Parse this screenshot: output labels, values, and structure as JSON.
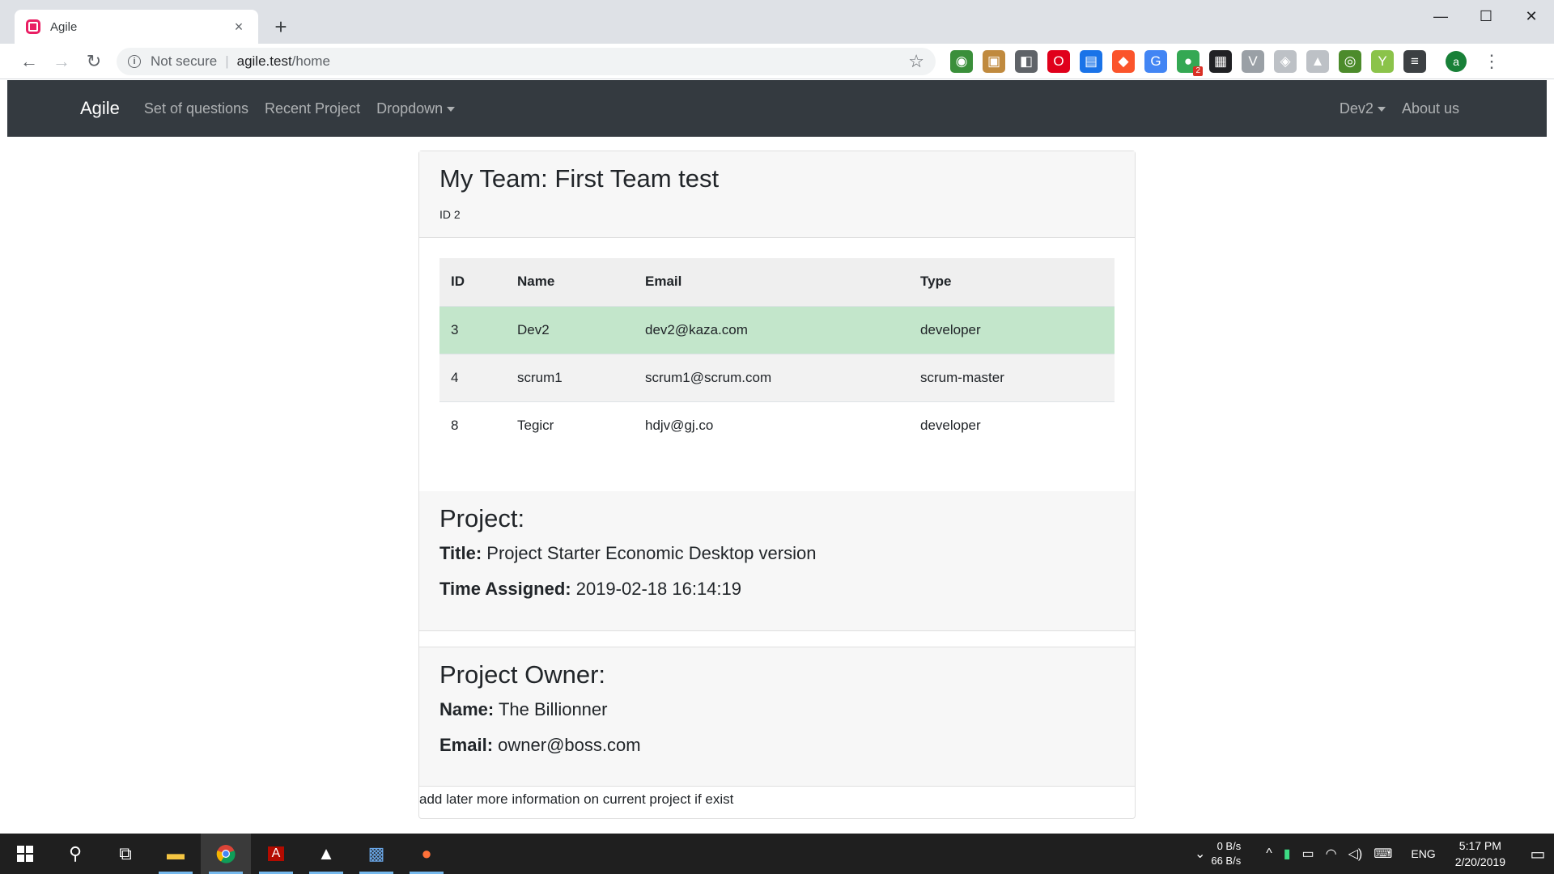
{
  "browser": {
    "tab_title": "Agile",
    "tab_close": "×",
    "new_tab": "+",
    "window_controls": {
      "minimize": "—",
      "maximize": "☐",
      "close": "✕"
    },
    "nav": {
      "back": "←",
      "forward": "→",
      "reload": "↻"
    },
    "address": {
      "security": "Not secure",
      "host": "agile.test",
      "path": "/home",
      "info_icon": "i",
      "star": "☆"
    },
    "profile_initial": "a",
    "menu": "⋮",
    "extensions": [
      {
        "icon": "globe-extension-icon",
        "color": "#3a8f3a",
        "glyph": "◉"
      },
      {
        "icon": "box-extension-icon",
        "color": "#c08a3e",
        "glyph": "▣"
      },
      {
        "icon": "puzzle-extension-icon",
        "color": "#5f6368",
        "glyph": "◧"
      },
      {
        "icon": "opera-extension-icon",
        "color": "#e0001b",
        "glyph": "O"
      },
      {
        "icon": "window-extension-icon",
        "color": "#1a73e8",
        "glyph": "▤"
      },
      {
        "icon": "brave-extension-icon",
        "color": "#fb542b",
        "glyph": "◆"
      },
      {
        "icon": "translate-extension-icon",
        "color": "#4285f4",
        "glyph": "G"
      },
      {
        "icon": "badge-extension-icon",
        "color": "#34a853",
        "glyph": "●",
        "badge": "2"
      },
      {
        "icon": "qr-extension-icon",
        "color": "#202124",
        "glyph": "▦"
      },
      {
        "icon": "v-extension-icon",
        "color": "#9aa0a6",
        "glyph": "V"
      },
      {
        "icon": "shield-extension-icon",
        "color": "#bdc1c6",
        "glyph": "◈"
      },
      {
        "icon": "drive-extension-icon",
        "color": "#bdc1c6",
        "glyph": "▲"
      },
      {
        "icon": "search-extension-icon",
        "color": "#4c8b2b",
        "glyph": "◎"
      },
      {
        "icon": "y-extension-icon",
        "color": "#8bc34a",
        "glyph": "Y"
      },
      {
        "icon": "list-extension-icon",
        "color": "#3c4043",
        "glyph": "≡"
      }
    ]
  },
  "navbar": {
    "brand": "Agile",
    "links": [
      "Set of questions",
      "Recent Project",
      "Dropdown"
    ],
    "user": "Dev2",
    "about": "About us"
  },
  "team": {
    "title": "My Team: First Team test",
    "subtitle": "ID 2",
    "columns": [
      "ID",
      "Name",
      "Email",
      "Type"
    ],
    "rows": [
      {
        "id": "3",
        "name": "Dev2",
        "email": "dev2@kaza.com",
        "type": "developer"
      },
      {
        "id": "4",
        "name": "scrum1",
        "email": "scrum1@scrum.com",
        "type": "scrum-master"
      },
      {
        "id": "8",
        "name": "Tegicr",
        "email": "hdjv@gj.co",
        "type": "developer"
      }
    ]
  },
  "project": {
    "heading": "Project:",
    "title_label": "Title:",
    "title_value": "Project Starter Economic Desktop version",
    "time_label": "Time Assigned:",
    "time_value": "2019-02-18 16:14:19"
  },
  "owner": {
    "heading": "Project Owner:",
    "name_label": "Name:",
    "name_value": "The Billionner",
    "email_label": "Email:",
    "email_value": "owner@boss.com"
  },
  "footer_note": "add later more information on current project if exist",
  "taskbar": {
    "net_up": "0 B/s",
    "net_down": "66 B/s",
    "lang": "ENG",
    "time": "5:17 PM",
    "date": "2/20/2019"
  }
}
